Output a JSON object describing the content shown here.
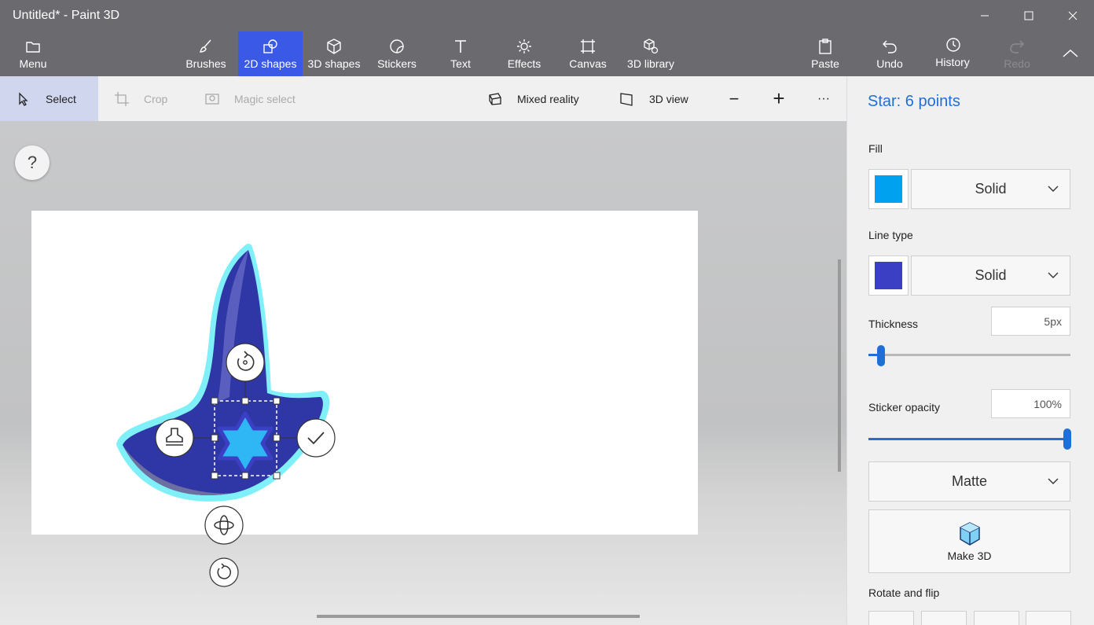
{
  "window": {
    "title": "Untitled* - Paint 3D",
    "controls": [
      "minimize-icon",
      "maximize-icon",
      "close-icon"
    ]
  },
  "ribbon": {
    "menu": "Menu",
    "tabs": {
      "brushes": "Brushes",
      "shapes2d": "2D shapes",
      "shapes3d": "3D shapes",
      "stickers": "Stickers",
      "text": "Text",
      "effects": "Effects",
      "canvas": "Canvas",
      "library3d": "3D library"
    },
    "actions": {
      "paste": "Paste",
      "undo": "Undo",
      "history": "History",
      "redo": "Redo"
    },
    "active_tab": "2D shapes"
  },
  "toolbar": {
    "select": "Select",
    "crop": "Crop",
    "magic_select": "Magic select",
    "mixed_reality": "Mixed reality",
    "view3d": "3D view",
    "zoom_out": "−",
    "zoom_in": "+",
    "more": "···"
  },
  "workspace": {
    "help": "?"
  },
  "panel": {
    "title": "Star: 6 points",
    "fill_label": "Fill",
    "fill_color": "#00a2f0",
    "fill_style": "Solid",
    "line_label": "Line type",
    "line_color": "#3b3fc4",
    "line_style": "Solid",
    "thickness_label": "Thickness",
    "thickness_value": "5px",
    "thickness_level": 0.05,
    "opacity_label": "Sticker opacity",
    "opacity_value": "100%",
    "opacity_level": 1.0,
    "material": "Matte",
    "make3d": "Make 3D",
    "rotate_label": "Rotate and flip"
  },
  "colors": {
    "accent": "#3a59e6",
    "title_blue": "#1f6fd6",
    "shape_dark": "#2f36a5",
    "star_fill": "#2eb6f5"
  }
}
